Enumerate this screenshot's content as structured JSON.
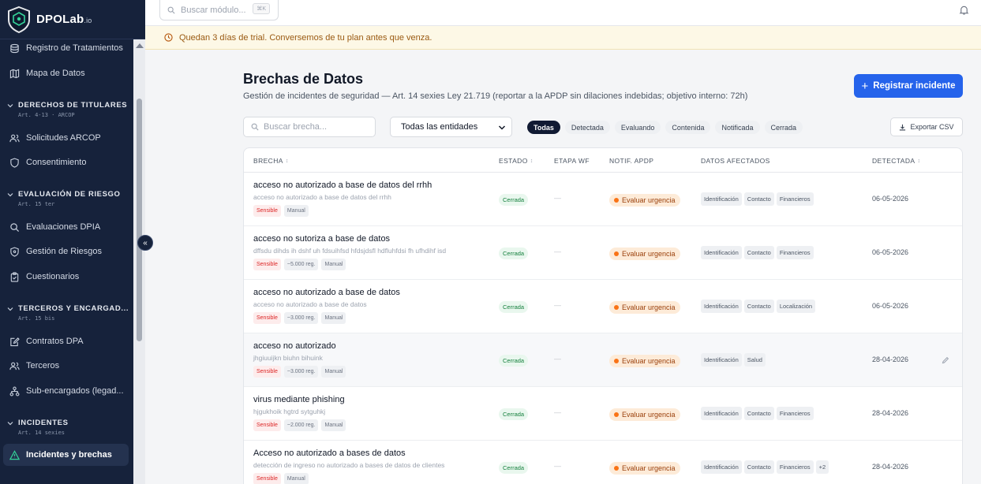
{
  "brand": {
    "name": "DPOLab",
    "suffix": ".io"
  },
  "sidebar": {
    "items_top": [
      {
        "label": "Registro de Tratamientos",
        "icon": "database-icon"
      },
      {
        "label": "Mapa de Datos",
        "icon": "map-icon"
      }
    ],
    "sections": [
      {
        "title": "DERECHOS DE TITULARES",
        "sub": "Art. 4-13 · ARCOP",
        "items": [
          {
            "label": "Solicitudes ARCOP",
            "icon": "users-icon"
          },
          {
            "label": "Consentimiento",
            "icon": "shield-icon"
          }
        ]
      },
      {
        "title": "EVALUACIÓN DE RIESGO",
        "sub": "Art. 15 ter",
        "items": [
          {
            "label": "Evaluaciones DPIA",
            "icon": "search-icon"
          },
          {
            "label": "Gestión de Riesgos",
            "icon": "shield-icon"
          },
          {
            "label": "Cuestionarios",
            "icon": "clipboard-icon"
          }
        ]
      },
      {
        "title": "TERCEROS Y ENCARGAD...",
        "sub": "Art. 15 bis",
        "items": [
          {
            "label": "Contratos DPA",
            "icon": "document-edit-icon"
          },
          {
            "label": "Terceros",
            "icon": "users-icon"
          },
          {
            "label": "Sub-encargados (legad...",
            "icon": "hierarchy-icon"
          }
        ]
      },
      {
        "title": "INCIDENTES",
        "sub": "Art. 14 sexies",
        "items": [
          {
            "label": "Incidentes y brechas",
            "icon": "alert-triangle-icon",
            "active": true
          }
        ]
      }
    ]
  },
  "topbar": {
    "search_placeholder": "Buscar módulo...",
    "shortcut": "⌘K"
  },
  "trial": {
    "message": "Quedan 3 días de trial. Conversemos de tu plan antes que venza."
  },
  "page": {
    "title": "Brechas de Datos",
    "subtitle": "Gestión de incidentes de seguridad — Art. 14 sexies Ley 21.719 (reportar a la APDP sin dilaciones indebidas; objetivo interno: 72h)",
    "primary_button": "Registrar incidente",
    "search_placeholder": "Buscar brecha...",
    "entity_select": "Todas las entidades",
    "filters": [
      "Todas",
      "Detectada",
      "Evaluando",
      "Contenida",
      "Notificada",
      "Cerrada"
    ],
    "active_filter": "Todas",
    "export_label": "Exportar CSV"
  },
  "table": {
    "columns": {
      "brecha": "BRECHA",
      "estado": "ESTADO",
      "etapa": "ETAPA WF",
      "notif": "NOTIF. APDP",
      "datos": "DATOS AFECTADOS",
      "detectada": "DETECTADA"
    },
    "sort_glyph": "↕",
    "rows": [
      {
        "title": "acceso no autorizado a base de datos del rrhh",
        "desc": "acceso no autorizado a base de datos del rrhh",
        "tags": [
          "Sensible",
          "Manual"
        ],
        "estado": "Cerrada",
        "etapa": "—",
        "notif": "Evaluar urgencia",
        "datos": [
          "Identificación",
          "Contacto",
          "Financieros"
        ],
        "fecha": "06-05-2026"
      },
      {
        "title": "acceso no sutoriza a base de datos",
        "desc": "dffsdu dihds ih dshf uh fdsuihfsd hfdsjdsfl hdfluhfdsi fh ufhdihf isd",
        "tags": [
          "Sensible",
          "~5.000 reg.",
          "Manual"
        ],
        "estado": "Cerrada",
        "etapa": "—",
        "notif": "Evaluar urgencia",
        "datos": [
          "Identificación",
          "Contacto",
          "Financieros"
        ],
        "fecha": "06-05-2026"
      },
      {
        "title": "acceso no autorizado a base de datos",
        "desc": "acceso no autorizado a base de datos",
        "tags": [
          "Sensible",
          "~3.000 reg.",
          "Manual"
        ],
        "estado": "Cerrada",
        "etapa": "—",
        "notif": "Evaluar urgencia",
        "datos": [
          "Identificación",
          "Contacto",
          "Localización"
        ],
        "fecha": "06-05-2026"
      },
      {
        "title": "acceso no autorizado",
        "desc": "jhgiuuijkn biuhn bihuink",
        "tags": [
          "Sensible",
          "~3.000 reg.",
          "Manual"
        ],
        "estado": "Cerrada",
        "etapa": "—",
        "notif": "Evaluar urgencia",
        "datos": [
          "Identificación",
          "Salud"
        ],
        "fecha": "28-04-2026",
        "hover": true
      },
      {
        "title": "virus mediante phishing",
        "desc": "hjgukhoik hgtrd sytguhkj",
        "tags": [
          "Sensible",
          "~2.000 reg.",
          "Manual"
        ],
        "estado": "Cerrada",
        "etapa": "—",
        "notif": "Evaluar urgencia",
        "datos": [
          "Identificación",
          "Contacto",
          "Financieros"
        ],
        "fecha": "28-04-2026"
      },
      {
        "title": "Acceso no autorizado a bases de datos",
        "desc": "detección de ingreso no autorizado a bases de datos de clientes",
        "tags": [
          "Sensible",
          "Manual"
        ],
        "estado": "Cerrada",
        "etapa": "—",
        "notif": "Evaluar urgencia",
        "datos": [
          "Identificación",
          "Contacto",
          "Financieros",
          "+2"
        ],
        "fecha": "28-04-2026"
      }
    ]
  }
}
